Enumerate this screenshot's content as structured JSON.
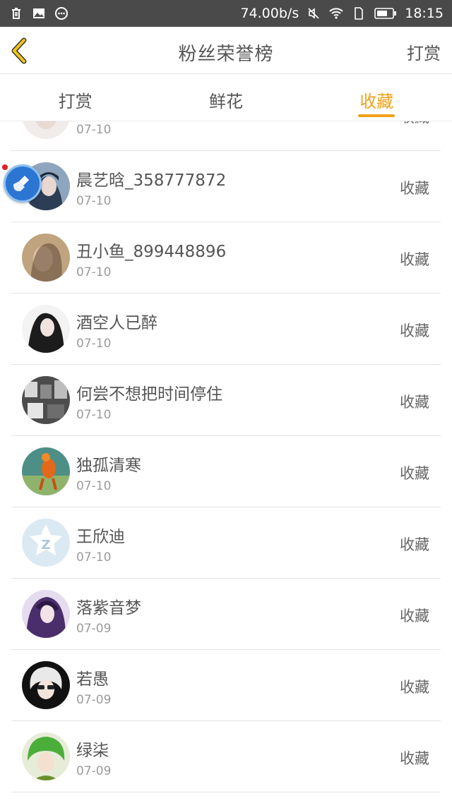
{
  "status_bar": {
    "speed": "74.00b/s",
    "time": "18:15",
    "icons": [
      "trash-icon",
      "image-icon",
      "more-icon",
      "mute-icon",
      "wifi-icon",
      "sim-icon",
      "battery-icon"
    ]
  },
  "header": {
    "back_icon": "chevron-left-icon",
    "title": "粉丝荣誉榜",
    "action": "打赏"
  },
  "tabs": [
    {
      "label": "打赏",
      "active": false
    },
    {
      "label": "鲜花",
      "active": false
    },
    {
      "label": "收藏",
      "active": true
    }
  ],
  "partial_row": {
    "date": "07-10",
    "action": "收藏"
  },
  "rows": [
    {
      "name": "晨艺晗_358777872",
      "date": "07-10",
      "action": "收藏"
    },
    {
      "name": "丑小鱼_899448896",
      "date": "07-10",
      "action": "收藏"
    },
    {
      "name": "酒空人已醉",
      "date": "07-10",
      "action": "收藏"
    },
    {
      "name": "何尝不想把时间停住",
      "date": "07-10",
      "action": "收藏"
    },
    {
      "name": "独孤清寒",
      "date": "07-10",
      "action": "收藏"
    },
    {
      "name": "王欣迪",
      "date": "07-10",
      "action": "收藏"
    },
    {
      "name": "落紫音梦",
      "date": "07-09",
      "action": "收藏"
    },
    {
      "name": "若愚",
      "date": "07-09",
      "action": "收藏"
    },
    {
      "name": "绿柒",
      "date": "07-09",
      "action": "收藏"
    }
  ],
  "colors": {
    "accent": "#f0a11a",
    "status_bar": "#4a4a4a"
  }
}
